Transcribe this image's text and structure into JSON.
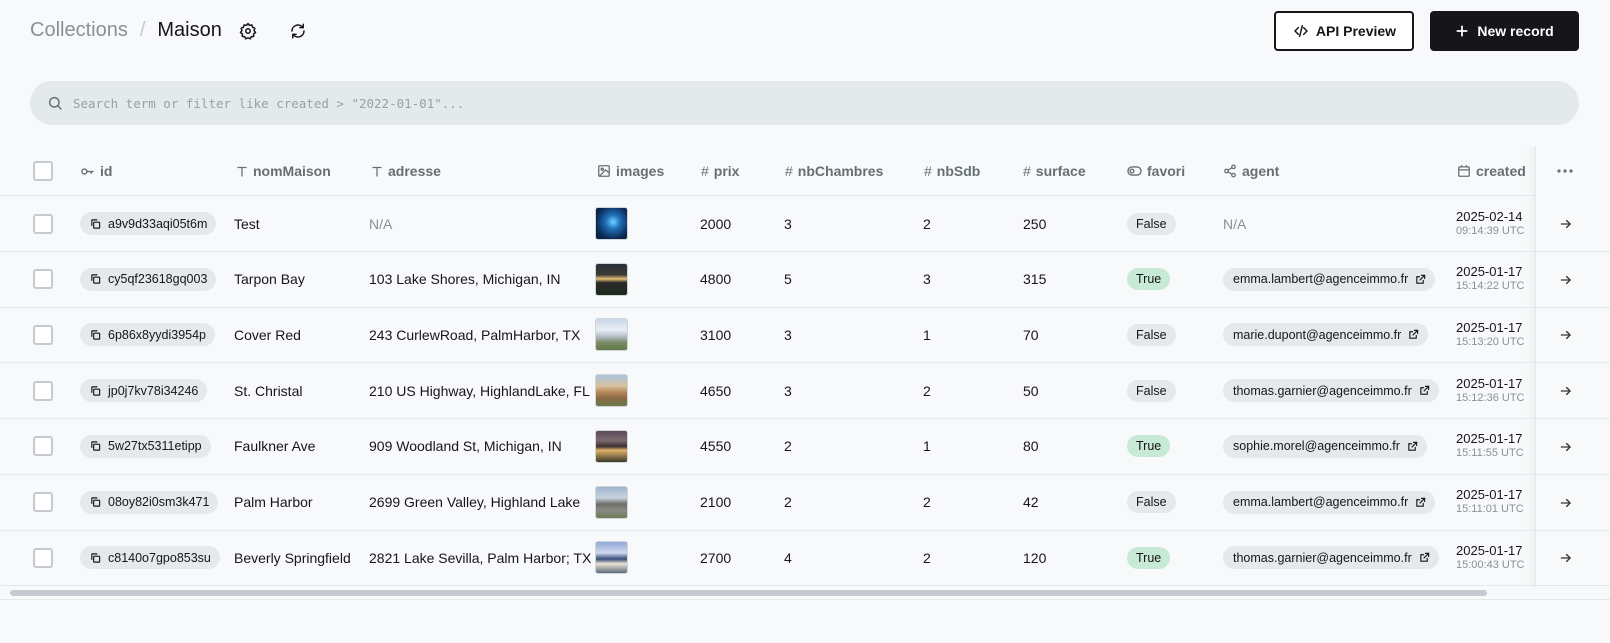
{
  "header": {
    "breadcrumb_root": "Collections",
    "breadcrumb_separator": "/",
    "collection_name": "Maison",
    "api_preview_label": "API Preview",
    "new_record_label": "New record"
  },
  "search": {
    "placeholder": "Search term or filter like created > \"2022-01-01\"..."
  },
  "columns": {
    "id": "id",
    "nomMaison": "nomMaison",
    "adresse": "adresse",
    "images": "images",
    "prix": "prix",
    "nbChambres": "nbChambres",
    "nbSdb": "nbSdb",
    "surface": "surface",
    "favori": "favori",
    "agent": "agent",
    "created": "created"
  },
  "rows": [
    {
      "id": "a9v9d33aqi05t6m",
      "nomMaison": "Test",
      "adresse": "N/A",
      "image": "blue-abstract",
      "prix": "2000",
      "nbChambres": "3",
      "nbSdb": "2",
      "surface": "250",
      "favori": "False",
      "agent": "N/A",
      "created_date": "2025-02-14",
      "created_time": "09:14:39 UTC"
    },
    {
      "id": "cy5qf23618gq003",
      "nomMaison": "Tarpon Bay",
      "adresse": "103 Lake Shores, Michigan, IN",
      "image": "modern-house-night",
      "prix": "4800",
      "nbChambres": "5",
      "nbSdb": "3",
      "surface": "315",
      "favori": "True",
      "agent": "emma.lambert@agenceimmo.fr",
      "created_date": "2025-01-17",
      "created_time": "15:14:22 UTC"
    },
    {
      "id": "6p86x8yydi3954p",
      "nomMaison": "Cover Red",
      "adresse": "243 CurlewRoad, PalmHarbor, TX",
      "image": "white-house",
      "prix": "3100",
      "nbChambres": "3",
      "nbSdb": "1",
      "surface": "70",
      "favori": "False",
      "agent": "marie.dupont@agenceimmo.fr",
      "created_date": "2025-01-17",
      "created_time": "15:13:20 UTC"
    },
    {
      "id": "jp0j7kv78i34246",
      "nomMaison": "St. Christal",
      "adresse": "210 US Highway, HighlandLake, FL",
      "image": "beige-house",
      "prix": "4650",
      "nbChambres": "3",
      "nbSdb": "2",
      "surface": "50",
      "favori": "False",
      "agent": "thomas.garnier@agenceimmo.fr",
      "created_date": "2025-01-17",
      "created_time": "15:12:36 UTC"
    },
    {
      "id": "5w27tx5311etipp",
      "nomMaison": "Faulkner Ave",
      "adresse": "909 Woodland St, Michigan, IN",
      "image": "house-dusk",
      "prix": "4550",
      "nbChambres": "2",
      "nbSdb": "1",
      "surface": "80",
      "favori": "True",
      "agent": "sophie.morel@agenceimmo.fr",
      "created_date": "2025-01-17",
      "created_time": "15:11:55 UTC"
    },
    {
      "id": "08oy82i0sm3k471",
      "nomMaison": "Palm Harbor",
      "adresse": "2699 Green Valley, Highland Lake",
      "image": "grey-house",
      "prix": "2100",
      "nbChambres": "2",
      "nbSdb": "2",
      "surface": "42",
      "favori": "False",
      "agent": "emma.lambert@agenceimmo.fr",
      "created_date": "2025-01-17",
      "created_time": "15:11:01 UTC"
    },
    {
      "id": "c8140o7gpo853su",
      "nomMaison": "Beverly Springfield",
      "adresse": "2821 Lake Sevilla, Palm Harbor; TX",
      "image": "blue-house",
      "prix": "2700",
      "nbChambres": "4",
      "nbSdb": "2",
      "surface": "120",
      "favori": "True",
      "agent": "thomas.garnier@agenceimmo.fr",
      "created_date": "2025-01-17",
      "created_time": "15:00:43 UTC"
    }
  ],
  "colors": {
    "primary": "#16161a",
    "badge_bg": "#e4e9ec",
    "true_badge_bg": "#c7ead6",
    "muted_text": "#8a8f99"
  }
}
